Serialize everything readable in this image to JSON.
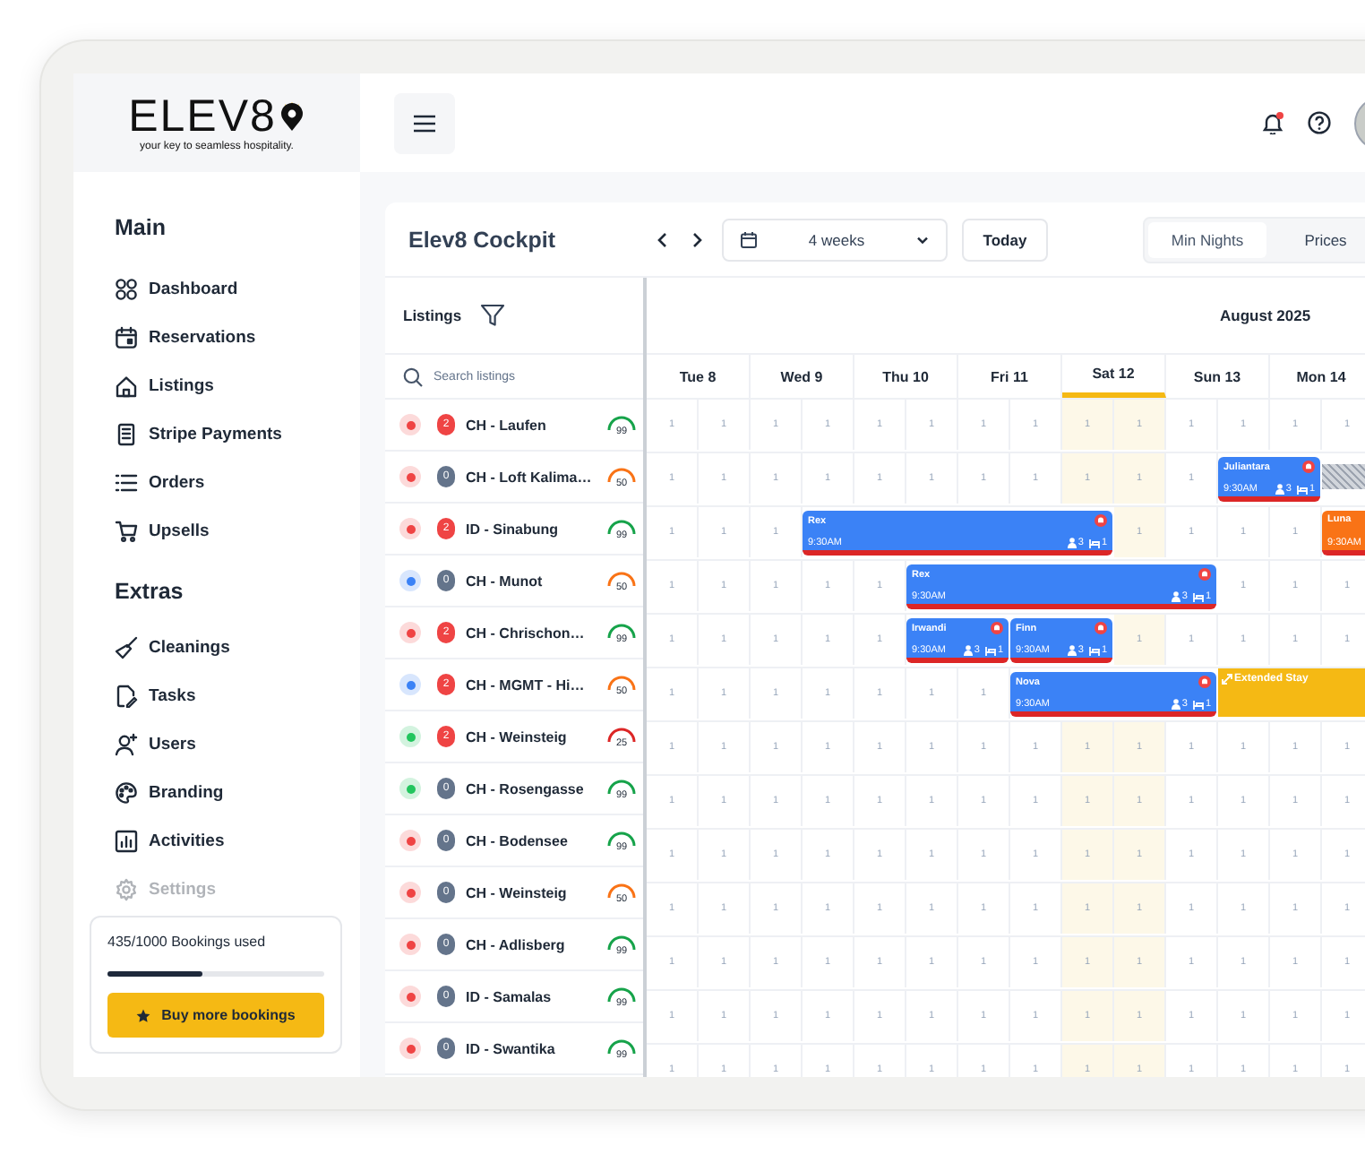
{
  "sidebar": {
    "logo": {
      "wordmark": "ELEV8",
      "tagline": "your key to seamless hospitality."
    },
    "sections": [
      {
        "title": "Main",
        "items": [
          {
            "label": "Dashboard",
            "disabled": false
          },
          {
            "label": "Reservations",
            "disabled": false
          },
          {
            "label": "Listings",
            "disabled": false
          },
          {
            "label": "Stripe Payments",
            "disabled": false
          },
          {
            "label": "Orders",
            "disabled": false
          },
          {
            "label": "Upsells",
            "disabled": false
          }
        ]
      },
      {
        "title": "Extras",
        "items": [
          {
            "label": "Cleanings",
            "disabled": false
          },
          {
            "label": "Tasks",
            "disabled": false
          },
          {
            "label": "Users",
            "disabled": false
          },
          {
            "label": "Branding",
            "disabled": false
          },
          {
            "label": "Activities",
            "disabled": false
          },
          {
            "label": "Settings",
            "disabled": true
          }
        ]
      }
    ],
    "usage": {
      "text": "435/1000 Bookings used",
      "level": 0.435,
      "button": "Buy more bookings"
    }
  },
  "topbar": {
    "notifications_unread": true
  },
  "toolbar": {
    "title": "Elev8 Cockpit",
    "range": "4 weeks",
    "today_button": "Today",
    "views": [
      {
        "label": "Min Nights",
        "selected": true
      },
      {
        "label": "Prices",
        "selected": false
      }
    ]
  },
  "listings_panel": {
    "title": "Listings",
    "search": {
      "placeholder": "Search listings"
    }
  },
  "calendar": {
    "month": "August 2025",
    "days": [
      {
        "label": "Tue 8",
        "today": false
      },
      {
        "label": "Wed 9",
        "today": false
      },
      {
        "label": "Thu 10",
        "today": false
      },
      {
        "label": "Fri 11",
        "today": false
      },
      {
        "label": "Sat 12",
        "today": true
      },
      {
        "label": "Sun 13",
        "today": false
      },
      {
        "label": "Mon 14",
        "today": false
      }
    ]
  },
  "listings": [
    {
      "name": "CH - Laufen",
      "color": "#ef4444",
      "badge": "2",
      "alert": true,
      "score": {
        "text": "99",
        "color": "#16a34a"
      },
      "slots": [
        {
          "kind": "cell",
          "text": "1"
        },
        {
          "kind": "cell",
          "text": "1"
        },
        {
          "kind": "cell",
          "text": "1"
        },
        {
          "kind": "cell",
          "text": "1"
        },
        {
          "kind": "cell",
          "text": "1"
        },
        {
          "kind": "cell",
          "text": "1"
        },
        {
          "kind": "cell",
          "text": "1"
        },
        {
          "kind": "cell",
          "text": "1"
        },
        {
          "kind": "cell",
          "text": "1"
        },
        {
          "kind": "cell",
          "text": "1"
        },
        {
          "kind": "cell",
          "text": "1"
        },
        {
          "kind": "cell",
          "text": "1"
        },
        {
          "kind": "cell",
          "text": "1"
        },
        {
          "kind": "cell",
          "text": "1"
        }
      ]
    },
    {
      "name": "CH - Loft Kalima…",
      "color": "#ef4444",
      "badge": "0",
      "alert": false,
      "score": {
        "text": "50",
        "color": "#f97316"
      },
      "slots": [
        {
          "kind": "cell",
          "text": "1"
        },
        {
          "kind": "cell",
          "text": "1"
        },
        {
          "kind": "cell",
          "text": "1"
        },
        {
          "kind": "cell",
          "text": "1"
        },
        {
          "kind": "cell",
          "text": "1"
        },
        {
          "kind": "cell",
          "text": "1"
        },
        {
          "kind": "cell",
          "text": "1"
        },
        {
          "kind": "cell",
          "text": "1"
        },
        {
          "kind": "cell",
          "text": "1"
        },
        {
          "kind": "cell",
          "text": "1"
        },
        {
          "kind": "cell",
          "text": "1"
        },
        {
          "kind": "booking",
          "guest": "Juliantara",
          "time": "9:30AM",
          "guests": "3",
          "beds": "1",
          "alert": true,
          "color": "#3b82f6"
        },
        {
          "kind": "covered"
        },
        {
          "kind": "blocked"
        }
      ]
    },
    {
      "name": "ID - Sinabung",
      "color": "#ef4444",
      "badge": "2",
      "alert": true,
      "score": {
        "text": "99",
        "color": "#16a34a"
      },
      "slots": [
        {
          "kind": "cell",
          "text": "1"
        },
        {
          "kind": "cell",
          "text": "1"
        },
        {
          "kind": "cell",
          "text": "1"
        },
        {
          "kind": "booking",
          "guest": "Rex",
          "time": "9:30AM",
          "guests": "3",
          "beds": "1",
          "alert": true,
          "color": "#3b82f6"
        },
        {
          "kind": "covered"
        },
        {
          "kind": "covered"
        },
        {
          "kind": "covered"
        },
        {
          "kind": "covered"
        },
        {
          "kind": "covered"
        },
        {
          "kind": "cell",
          "text": "1"
        },
        {
          "kind": "cell",
          "text": "1"
        },
        {
          "kind": "cell",
          "text": "1"
        },
        {
          "kind": "cell",
          "text": "1"
        },
        {
          "kind": "booking",
          "guest": "Luna",
          "time": "9:30AM",
          "alert": false,
          "color": "#f97316"
        }
      ]
    },
    {
      "name": "CH - Munot",
      "color": "#3b82f6",
      "badge": "0",
      "alert": false,
      "score": {
        "text": "50",
        "color": "#f97316"
      },
      "slots": [
        {
          "kind": "cell",
          "text": "1"
        },
        {
          "kind": "cell",
          "text": "1"
        },
        {
          "kind": "cell",
          "text": "1"
        },
        {
          "kind": "cell",
          "text": "1"
        },
        {
          "kind": "cell",
          "text": "1"
        },
        {
          "kind": "booking",
          "guest": "Rex",
          "time": "9:30AM",
          "guests": "3",
          "beds": "1",
          "alert": true,
          "color": "#3b82f6"
        },
        {
          "kind": "covered"
        },
        {
          "kind": "covered"
        },
        {
          "kind": "covered"
        },
        {
          "kind": "covered"
        },
        {
          "kind": "covered"
        },
        {
          "kind": "cell",
          "text": "1"
        },
        {
          "kind": "cell",
          "text": "1"
        },
        {
          "kind": "cell",
          "text": "1"
        }
      ]
    },
    {
      "name": "CH - Chrischon…",
      "color": "#ef4444",
      "badge": "2",
      "alert": true,
      "score": {
        "text": "99",
        "color": "#16a34a"
      },
      "slots": [
        {
          "kind": "cell",
          "text": "1"
        },
        {
          "kind": "cell",
          "text": "1"
        },
        {
          "kind": "cell",
          "text": "1"
        },
        {
          "kind": "cell",
          "text": "1"
        },
        {
          "kind": "cell",
          "text": "1"
        },
        {
          "kind": "booking",
          "guest": "Irwandi",
          "time": "9:30AM",
          "guests": "3",
          "beds": "1",
          "alert": true,
          "color": "#3b82f6"
        },
        {
          "kind": "covered"
        },
        {
          "kind": "booking",
          "guest": "Finn",
          "time": "9:30AM",
          "guests": "3",
          "beds": "1",
          "alert": true,
          "color": "#3b82f6"
        },
        {
          "kind": "covered"
        },
        {
          "kind": "cell",
          "text": "1"
        },
        {
          "kind": "cell",
          "text": "1"
        },
        {
          "kind": "cell",
          "text": "1"
        },
        {
          "kind": "cell",
          "text": "1"
        },
        {
          "kind": "cell",
          "text": "1"
        }
      ]
    },
    {
      "name": "CH - MGMT - Hi…",
      "color": "#3b82f6",
      "badge": "2",
      "alert": true,
      "score": {
        "text": "50",
        "color": "#f97316"
      },
      "slots": [
        {
          "kind": "cell",
          "text": "1"
        },
        {
          "kind": "cell",
          "text": "1"
        },
        {
          "kind": "cell",
          "text": "1"
        },
        {
          "kind": "cell",
          "text": "1"
        },
        {
          "kind": "cell",
          "text": "1"
        },
        {
          "kind": "cell",
          "text": "1"
        },
        {
          "kind": "cell",
          "text": "1"
        },
        {
          "kind": "booking",
          "guest": "Nova",
          "time": "9:30AM",
          "guests": "3",
          "beds": "1",
          "alert": true,
          "color": "#3b82f6"
        },
        {
          "kind": "covered"
        },
        {
          "kind": "covered"
        },
        {
          "kind": "covered"
        },
        {
          "kind": "extended",
          "label": "Extended Stay"
        },
        {
          "kind": "covered"
        },
        {
          "kind": "covered"
        }
      ]
    },
    {
      "name": "CH - Weinsteig",
      "color": "#22c55e",
      "badge": "2",
      "alert": true,
      "score": {
        "text": "25",
        "color": "#dc2626"
      },
      "slots": [
        {
          "kind": "cell",
          "text": "1"
        },
        {
          "kind": "cell",
          "text": "1"
        },
        {
          "kind": "cell",
          "text": "1"
        },
        {
          "kind": "cell",
          "text": "1"
        },
        {
          "kind": "cell",
          "text": "1"
        },
        {
          "kind": "cell",
          "text": "1"
        },
        {
          "kind": "cell",
          "text": "1"
        },
        {
          "kind": "cell",
          "text": "1"
        },
        {
          "kind": "cell",
          "text": "1"
        },
        {
          "kind": "cell",
          "text": "1"
        },
        {
          "kind": "cell",
          "text": "1"
        },
        {
          "kind": "cell",
          "text": "1"
        },
        {
          "kind": "cell",
          "text": "1"
        },
        {
          "kind": "cell",
          "text": "1"
        }
      ]
    },
    {
      "name": "CH - Rosengasse",
      "color": "#22c55e",
      "badge": "0",
      "alert": false,
      "score": {
        "text": "99",
        "color": "#16a34a"
      },
      "slots": [
        {
          "kind": "cell",
          "text": "1"
        },
        {
          "kind": "cell",
          "text": "1"
        },
        {
          "kind": "cell",
          "text": "1"
        },
        {
          "kind": "cell",
          "text": "1"
        },
        {
          "kind": "cell",
          "text": "1"
        },
        {
          "kind": "cell",
          "text": "1"
        },
        {
          "kind": "cell",
          "text": "1"
        },
        {
          "kind": "cell",
          "text": "1"
        },
        {
          "kind": "cell",
          "text": "1"
        },
        {
          "kind": "cell",
          "text": "1"
        },
        {
          "kind": "cell",
          "text": "1"
        },
        {
          "kind": "cell",
          "text": "1"
        },
        {
          "kind": "cell",
          "text": "1"
        },
        {
          "kind": "cell",
          "text": "1"
        }
      ]
    },
    {
      "name": "CH - Bodensee",
      "color": "#ef4444",
      "badge": "0",
      "alert": false,
      "score": {
        "text": "99",
        "color": "#16a34a"
      },
      "slots": [
        {
          "kind": "cell",
          "text": "1"
        },
        {
          "kind": "cell",
          "text": "1"
        },
        {
          "kind": "cell",
          "text": "1"
        },
        {
          "kind": "cell",
          "text": "1"
        },
        {
          "kind": "cell",
          "text": "1"
        },
        {
          "kind": "cell",
          "text": "1"
        },
        {
          "kind": "cell",
          "text": "1"
        },
        {
          "kind": "cell",
          "text": "1"
        },
        {
          "kind": "cell",
          "text": "1"
        },
        {
          "kind": "cell",
          "text": "1"
        },
        {
          "kind": "cell",
          "text": "1"
        },
        {
          "kind": "cell",
          "text": "1"
        },
        {
          "kind": "cell",
          "text": "1"
        },
        {
          "kind": "cell",
          "text": "1"
        }
      ]
    },
    {
      "name": "CH - Weinsteig",
      "color": "#ef4444",
      "badge": "0",
      "alert": false,
      "score": {
        "text": "50",
        "color": "#f97316"
      },
      "slots": [
        {
          "kind": "cell",
          "text": "1"
        },
        {
          "kind": "cell",
          "text": "1"
        },
        {
          "kind": "cell",
          "text": "1"
        },
        {
          "kind": "cell",
          "text": "1"
        },
        {
          "kind": "cell",
          "text": "1"
        },
        {
          "kind": "cell",
          "text": "1"
        },
        {
          "kind": "cell",
          "text": "1"
        },
        {
          "kind": "cell",
          "text": "1"
        },
        {
          "kind": "cell",
          "text": "1"
        },
        {
          "kind": "cell",
          "text": "1"
        },
        {
          "kind": "cell",
          "text": "1"
        },
        {
          "kind": "cell",
          "text": "1"
        },
        {
          "kind": "cell",
          "text": "1"
        },
        {
          "kind": "cell",
          "text": "1"
        }
      ]
    },
    {
      "name": "CH - Adlisberg",
      "color": "#ef4444",
      "badge": "0",
      "alert": false,
      "score": {
        "text": "99",
        "color": "#16a34a"
      },
      "slots": [
        {
          "kind": "cell",
          "text": "1"
        },
        {
          "kind": "cell",
          "text": "1"
        },
        {
          "kind": "cell",
          "text": "1"
        },
        {
          "kind": "cell",
          "text": "1"
        },
        {
          "kind": "cell",
          "text": "1"
        },
        {
          "kind": "cell",
          "text": "1"
        },
        {
          "kind": "cell",
          "text": "1"
        },
        {
          "kind": "cell",
          "text": "1"
        },
        {
          "kind": "cell",
          "text": "1"
        },
        {
          "kind": "cell",
          "text": "1"
        },
        {
          "kind": "cell",
          "text": "1"
        },
        {
          "kind": "cell",
          "text": "1"
        },
        {
          "kind": "cell",
          "text": "1"
        },
        {
          "kind": "cell",
          "text": "1"
        }
      ]
    },
    {
      "name": "ID - Samalas",
      "color": "#ef4444",
      "badge": "0",
      "alert": false,
      "score": {
        "text": "99",
        "color": "#16a34a"
      },
      "slots": [
        {
          "kind": "cell",
          "text": "1"
        },
        {
          "kind": "cell",
          "text": "1"
        },
        {
          "kind": "cell",
          "text": "1"
        },
        {
          "kind": "cell",
          "text": "1"
        },
        {
          "kind": "cell",
          "text": "1"
        },
        {
          "kind": "cell",
          "text": "1"
        },
        {
          "kind": "cell",
          "text": "1"
        },
        {
          "kind": "cell",
          "text": "1"
        },
        {
          "kind": "cell",
          "text": "1"
        },
        {
          "kind": "cell",
          "text": "1"
        },
        {
          "kind": "cell",
          "text": "1"
        },
        {
          "kind": "cell",
          "text": "1"
        },
        {
          "kind": "cell",
          "text": "1"
        },
        {
          "kind": "cell",
          "text": "1"
        }
      ]
    },
    {
      "name": "ID - Swantika",
      "color": "#ef4444",
      "badge": "0",
      "alert": false,
      "score": {
        "text": "99",
        "color": "#16a34a"
      },
      "slots": [
        {
          "kind": "cell",
          "text": "1"
        },
        {
          "kind": "cell",
          "text": "1"
        },
        {
          "kind": "cell",
          "text": "1"
        },
        {
          "kind": "cell",
          "text": "1"
        },
        {
          "kind": "cell",
          "text": "1"
        },
        {
          "kind": "cell",
          "text": "1"
        },
        {
          "kind": "cell",
          "text": "1"
        },
        {
          "kind": "cell",
          "text": "1"
        },
        {
          "kind": "cell",
          "text": "1"
        },
        {
          "kind": "cell",
          "text": "1"
        },
        {
          "kind": "cell",
          "text": "1"
        },
        {
          "kind": "cell",
          "text": "1"
        },
        {
          "kind": "cell",
          "text": "1"
        },
        {
          "kind": "cell",
          "text": "1"
        }
      ]
    }
  ]
}
